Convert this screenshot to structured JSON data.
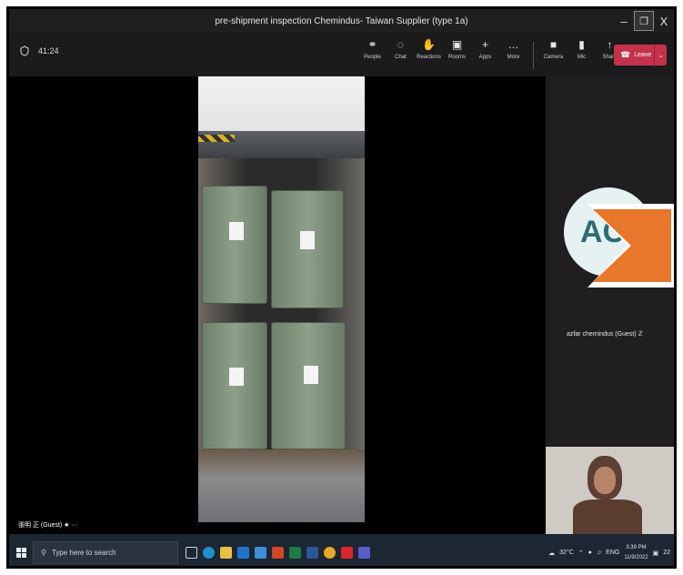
{
  "window": {
    "title": "pre-shipment inspection Chemindus- Taiwan Supplier (type 1a)",
    "minimize": "–",
    "maximize": "❐",
    "close": "X"
  },
  "toolbar": {
    "timer": "41:24",
    "tools": [
      {
        "label": "People",
        "icon": "people-icon",
        "glyph": "⚭"
      },
      {
        "label": "Chat",
        "icon": "chat-icon",
        "glyph": "◌"
      },
      {
        "label": "Reactions",
        "icon": "reactions-icon",
        "glyph": "✋"
      },
      {
        "label": "Rooms",
        "icon": "rooms-icon",
        "glyph": "▣"
      },
      {
        "label": "Apps",
        "icon": "apps-icon",
        "glyph": "+"
      },
      {
        "label": "More",
        "icon": "more-icon",
        "glyph": "…"
      }
    ],
    "media": [
      {
        "label": "Camera",
        "icon": "camera-icon",
        "glyph": "■"
      },
      {
        "label": "Mic",
        "icon": "mic-icon",
        "glyph": "▮"
      },
      {
        "label": "Share",
        "icon": "share-icon",
        "glyph": "↑"
      }
    ],
    "leave_label": "Leave",
    "leave_color": "#c4314b"
  },
  "stage": {
    "guest_label": "張明 正 (Guest) ★ ···"
  },
  "panel": {
    "avatar_initials": "AC",
    "participant_name": "azfar chemindus (Guest) ℤ",
    "arrow_color": "#e8762b"
  },
  "taskbar": {
    "search_placeholder": "Type here to search",
    "temperature": "32°C",
    "language": "ENG",
    "time": "3:39 PM",
    "date": "11/9/2022",
    "notifications": "22"
  }
}
